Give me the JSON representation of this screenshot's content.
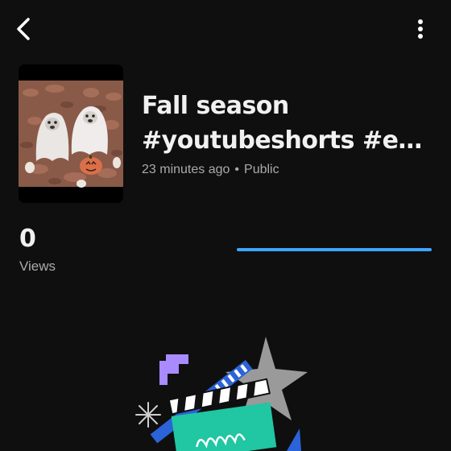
{
  "header": {
    "back_icon": "chevron-left-icon",
    "more_icon": "more-vertical-icon"
  },
  "video": {
    "thumbnail_icon": "thumbnail-image",
    "title_line1": "Fall season",
    "title_line2": "#youtubeshorts #e…",
    "time_ago": "23 minutes ago",
    "separator": "•",
    "visibility": "Public"
  },
  "stats": {
    "views_count": "0",
    "views_label": "Views",
    "progress_fraction": 1.0,
    "progress_color": "#3ea6ff"
  },
  "colors": {
    "background": "#0f0f0f",
    "accent": "#3ea6ff",
    "text_primary": "#f1f1f1",
    "text_secondary": "#aaaaaa"
  },
  "illustration_icon": "clapperboard-illustration"
}
